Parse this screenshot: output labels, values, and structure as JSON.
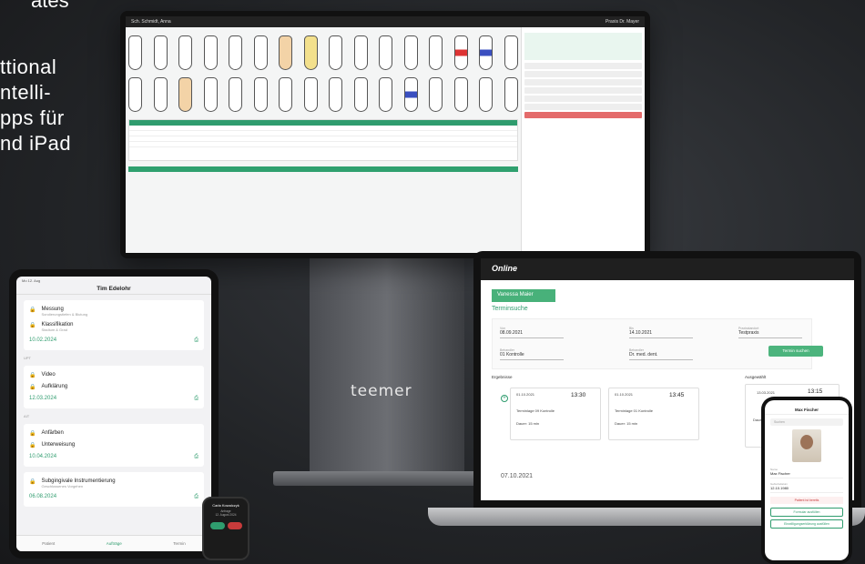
{
  "hero": {
    "top_fragment": "ates",
    "lines": [
      "ttional",
      "ntelli-",
      "pps für",
      "nd iPad"
    ]
  },
  "monitor": {
    "topbar_left": "Sch. Schmidt, Anna",
    "topbar_right": "Praxis Dr. Mayer",
    "brand": "teemer"
  },
  "tablet": {
    "status": "Mo 12. Aug",
    "title": "Tim Edelohr",
    "items": [
      {
        "title": "Messung",
        "sub": "Sondierungstiefen & Blutung"
      },
      {
        "title": "Klassifikation",
        "sub": "Stadium & Grad"
      }
    ],
    "date1": "10.02.2024",
    "section2": "UPT",
    "items2": [
      "Video",
      "Aufklärung"
    ],
    "date2": "12.03.2024",
    "section3": "AIT",
    "items3": [
      "Anfärben",
      "Unterweisung"
    ],
    "date3": "10.04.2024",
    "items4": [
      {
        "title": "Subgingivale Instrumentierung",
        "sub": "Geschlossenes Vorgehen"
      }
    ],
    "date4": "06.08.2024",
    "nav": [
      "Patient",
      "Aufträge",
      "Termin"
    ]
  },
  "watch": {
    "line1": "Carla Kowalczyk",
    "line2": "Anfrage",
    "line3": "12. August 2024"
  },
  "laptop": {
    "header": "Online",
    "patient": "Vanessa Maier",
    "heading": "Terminsuche",
    "fields": {
      "from_label": "Von",
      "from_value": "08.09.2021",
      "to_label": "Bis",
      "to_value": "14.10.2021",
      "treatment_label": "Behandler",
      "treatment_value": "01 Kontrolle",
      "dentist_label": "Behandler",
      "dentist_value": "Dr. med. dent.",
      "practice_label": "Praxisstandort",
      "practice_value": "Testpraxis"
    },
    "search_btn": "Termin suchen",
    "results_label": "Ergebnisse",
    "selected_label": "Ausgewählt",
    "cards": [
      {
        "date": "01.10.2021",
        "time": "13:30",
        "desc": "Terminlage 09 Kontrolle",
        "dur": "Dauer: 15 min"
      },
      {
        "date": "01.10.2021",
        "time": "13:45",
        "desc": "Terminlage 01 Kontrolle",
        "dur": "Dauer: 15 min"
      }
    ],
    "selected_card": {
      "date": "13.03.2021",
      "time": "13:15",
      "dur": "Dauer: 15 min"
    },
    "bottom_date": "07.10.2021"
  },
  "phone": {
    "title": "Max Fischer",
    "search": "Suchen",
    "name_label": "Name",
    "name_value": "Max Fischer",
    "dob_label": "Geburtsdatum",
    "dob_value": "12.10.1980",
    "warning": "Patient ist bereits",
    "btn1": "Formular ausfüllen",
    "btn2": "Einwilligungserklärung ausfüllen"
  }
}
